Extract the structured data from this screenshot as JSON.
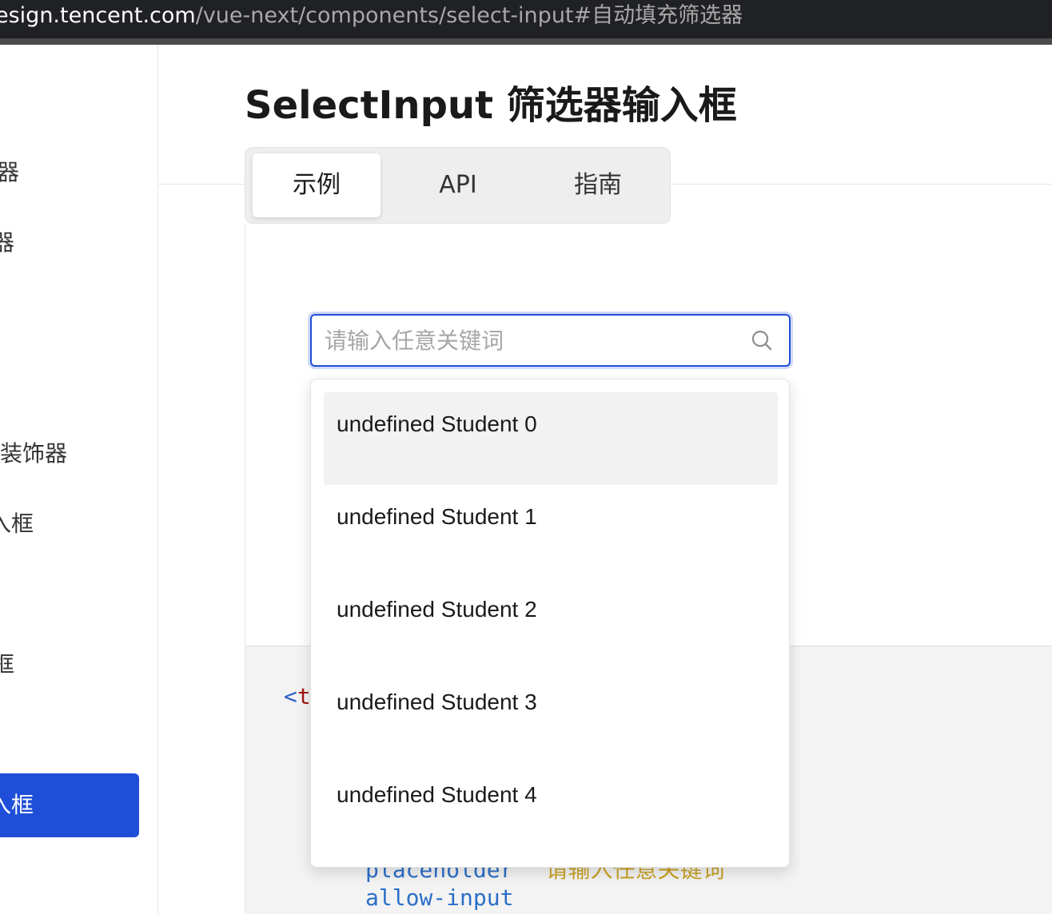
{
  "browser": {
    "url_host": "esign.tencent.com",
    "url_path": "/vue-next/components/select-input#自动填充筛选器"
  },
  "sidebar": {
    "items": [
      {
        "label": "器"
      },
      {
        "label": "器"
      },
      {
        "label": "装饰器"
      },
      {
        "label": "入框"
      },
      {
        "label": "框"
      }
    ],
    "active_item": "入框"
  },
  "page": {
    "title": "SelectInput 筛选器输入框"
  },
  "tabs": [
    {
      "label": "示例",
      "active": true
    },
    {
      "label": "API",
      "active": false
    },
    {
      "label": "指南",
      "active": false
    }
  ],
  "search": {
    "placeholder": "请输入任意关键词",
    "value": "",
    "icon": "search-icon"
  },
  "dropdown": {
    "options": [
      {
        "label": "undefined Student 0",
        "hovered": true
      },
      {
        "label": "undefined Student 1",
        "hovered": false
      },
      {
        "label": "undefined Student 2",
        "hovered": false
      },
      {
        "label": "undefined Student 3",
        "hovered": false
      },
      {
        "label": "undefined Student 4",
        "hovered": false
      }
    ]
  },
  "code": {
    "tag_open_bracket": "<",
    "tag_fragment": "t",
    "attr_placeholder": "placeholder",
    "attr_placeholder_value": "请输入任意关键词",
    "attr_allow_input": "allow-input"
  },
  "colors": {
    "accent": "#1f4fd8",
    "sidebar_active_bg": "#1f4fd8",
    "option_hover_bg": "#f2f2f2"
  }
}
